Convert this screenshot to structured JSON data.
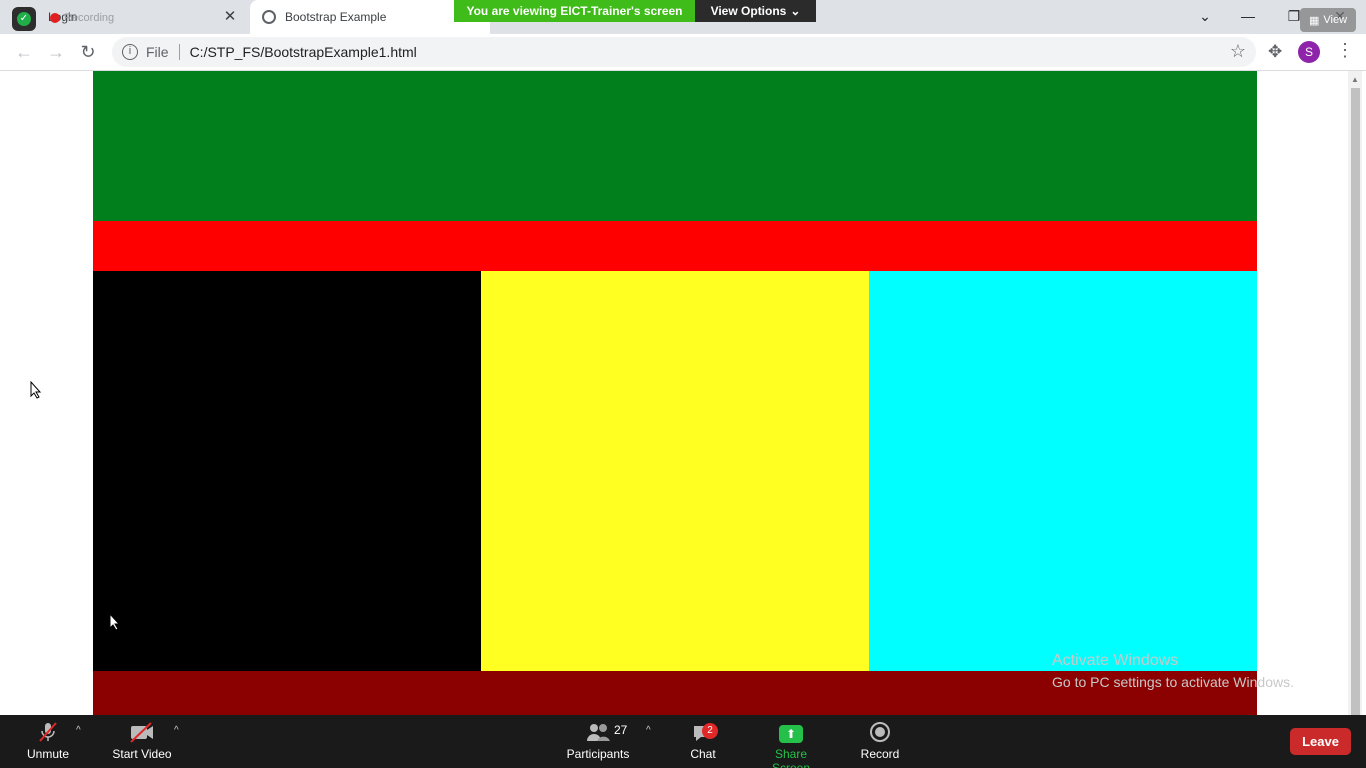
{
  "browser": {
    "tabs": [
      {
        "title": "Login",
        "active": false
      },
      {
        "title": "Bootstrap Example",
        "active": true
      }
    ],
    "recording_label": "Recording",
    "url_scheme_label": "File",
    "url": "C:/STP_FS/BootstrapExample1.html",
    "profile_initial": "S"
  },
  "zoom_overlay": {
    "share_banner": "You are viewing EICT-Trainer's screen",
    "view_options": "View Options",
    "view_chip": "View"
  },
  "page_blocks": {
    "header_color": "#027f1d",
    "red_bar_color": "#ff0000",
    "col1_color": "#000000",
    "col2_color": "#ffff22",
    "col3_color": "#00ffff",
    "footer_color": "#8b0000"
  },
  "watermark": {
    "title": "Activate Windows",
    "subtitle": "Go to PC settings to activate Windows."
  },
  "zoom_toolbar": {
    "unmute": "Unmute",
    "start_video": "Start Video",
    "participants": "Participants",
    "participants_count": "27",
    "chat": "Chat",
    "chat_badge": "2",
    "share_screen": "Share Screen",
    "record": "Record",
    "leave": "Leave"
  }
}
